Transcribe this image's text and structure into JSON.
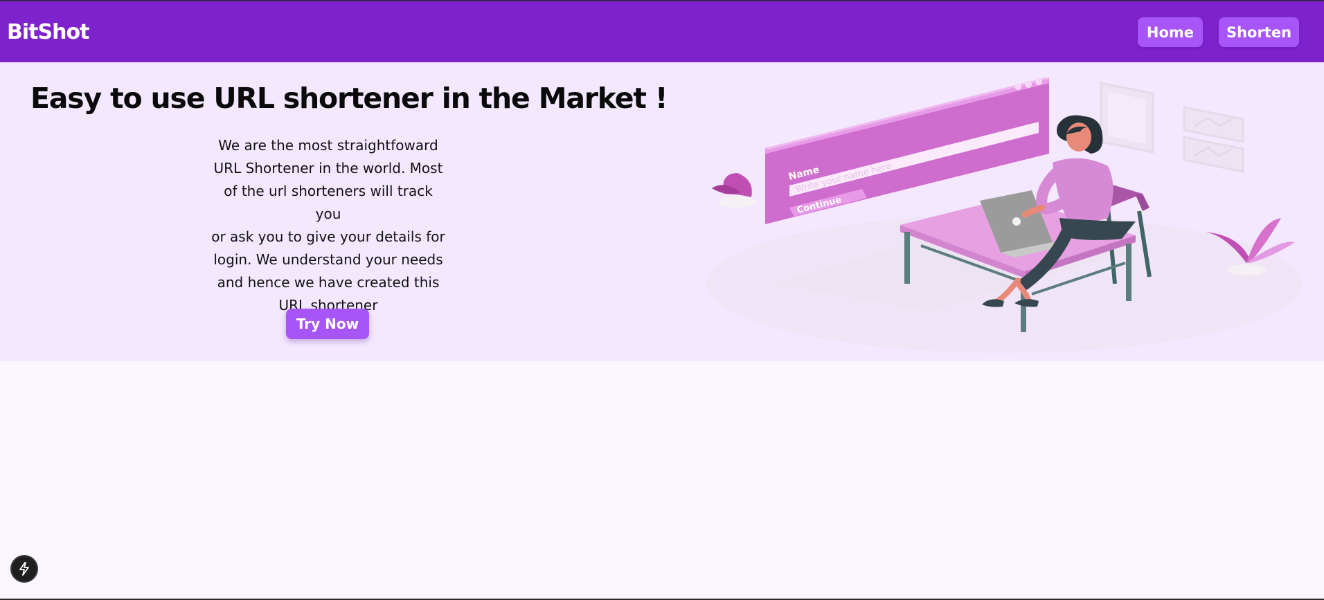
{
  "header": {
    "brand": "BitShot",
    "nav": [
      {
        "label": "Home"
      },
      {
        "label": "Shorten"
      }
    ]
  },
  "hero": {
    "title": "Easy to use URL shortener in the Market !",
    "description_lines": [
      "We are the most straightfoward",
      "URL Shortener in the world. Most",
      "of the url shorteners will track you",
      "or ask you to give your details for",
      "login. We understand your needs",
      "and hence we have created this",
      "URL shortener"
    ],
    "cta_label": "Try Now",
    "illustration": {
      "form_label": "Name",
      "input_placeholder": "Write your name here",
      "button_label": "Continue"
    }
  },
  "colors": {
    "navbar": "#7e22ce",
    "accent": "#a855f7",
    "hero_bg": "#f3e8ff",
    "page_bg": "#faf5ff"
  },
  "icons": {
    "dev_indicator": "lightning-bolt-icon"
  }
}
